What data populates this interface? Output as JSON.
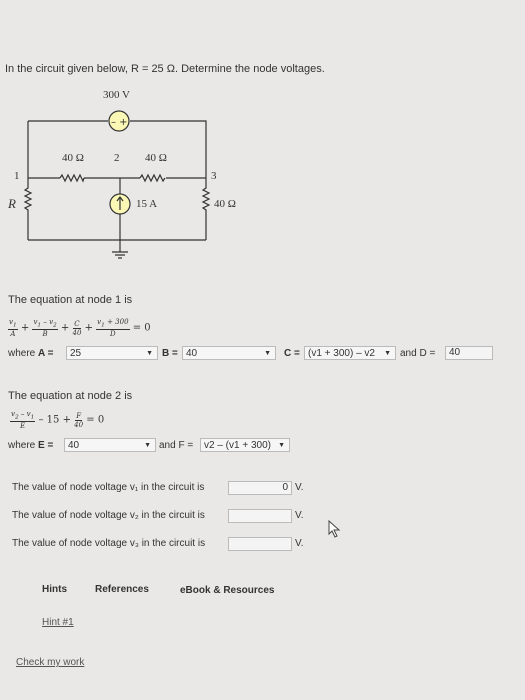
{
  "question": {
    "intro": "In the circuit given below, R = 25 Ω. Determine the node voltages."
  },
  "circuit": {
    "source_label": "300 V",
    "r1_label": "40 Ω",
    "r2_label": "40 Ω",
    "r3_label": "40 Ω",
    "node1": "1",
    "node2": "2",
    "node3": "3",
    "r_label": "R",
    "current_label": "15 A"
  },
  "node1": {
    "heading": "The equation at node 1 is",
    "where_label": "where",
    "a_label": "A =",
    "a_value": "25",
    "b_label": "B =",
    "b_value": "40",
    "c_label": "C =",
    "c_value": "(v1 + 300) – v2",
    "d_label": "and D =",
    "d_value": "40"
  },
  "node2": {
    "heading": "The equation at node 2 is",
    "where_label": "where",
    "e_label": "E =",
    "e_value": "40",
    "f_label": "and F =",
    "f_value": "v2 – (v1 + 300)"
  },
  "answers": {
    "v1_text": "The value of node voltage v₁ in the circuit is",
    "v1_value": "0",
    "v2_text": "The value of node voltage v₂ in the circuit is",
    "v2_value": "",
    "v3_text": "The value of node voltage v₃ in the circuit is",
    "v3_value": "",
    "unit": "V."
  },
  "tabs": {
    "hints": "Hints",
    "references": "References",
    "ebook": "eBook & Resources"
  },
  "links": {
    "hint1": "Hint #1",
    "check": "Check my work"
  }
}
